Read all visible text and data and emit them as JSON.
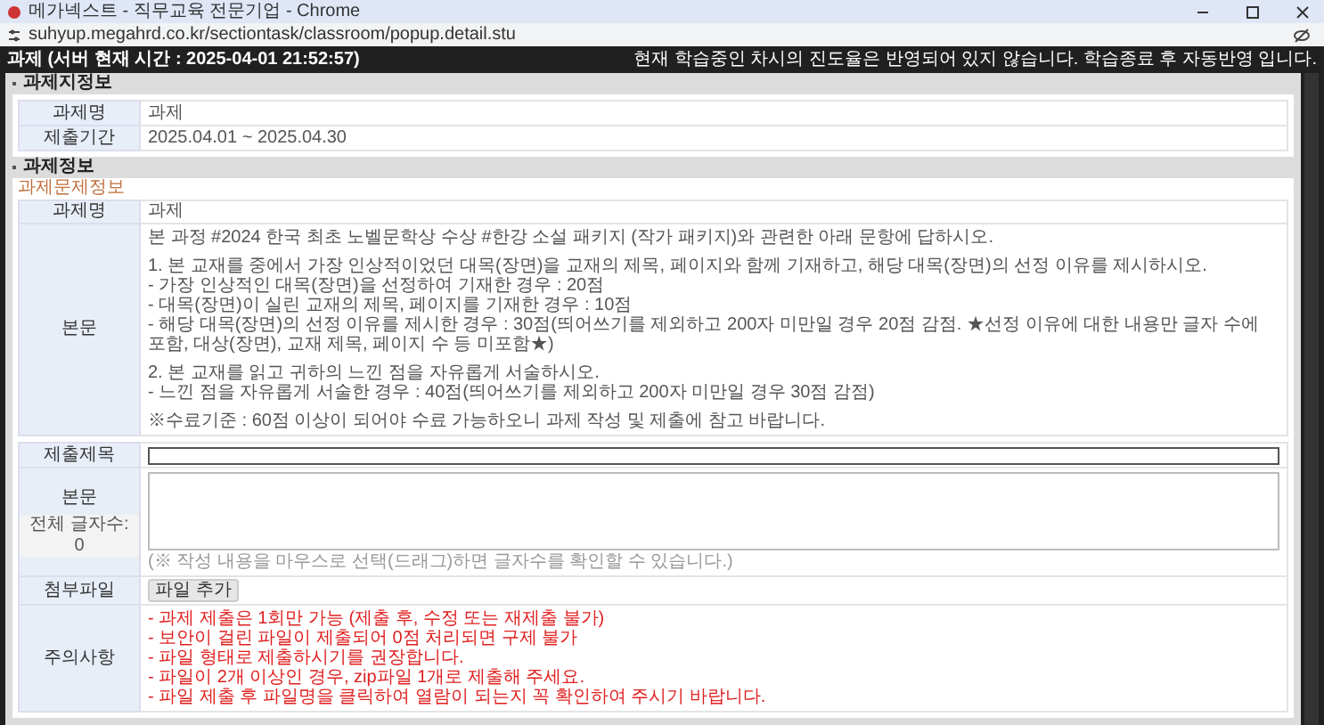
{
  "browser": {
    "title": "메가넥스트 - 직무교육 전문기업 - Chrome",
    "url": "suhyup.megahrd.co.kr/sectiontask/classroom/popup.detail.stu"
  },
  "header": {
    "title": "과제 (서버 현재 시간 : 2025-04-01 21:52:57)",
    "notice": "현재 학습중인 차시의 진도율은 반영되어 있지 않습니다. 학습종료 후 자동반영 입니다."
  },
  "assignment_info": {
    "heading": "과제지정보",
    "rows": [
      {
        "label": "과제명",
        "value": "과제"
      },
      {
        "label": "제출기간",
        "value": "2025.04.01 ~ 2025.04.30"
      }
    ]
  },
  "task_info": {
    "heading": "과제정보",
    "subheading": "과제문제정보",
    "rows": [
      {
        "label": "과제명",
        "value": "과제"
      }
    ],
    "body": {
      "label": "본문",
      "paragraphs": [
        [
          "본 과정 #2024 한국 최초 노벨문학상 수상 #한강 소설 패키지 (작가 패키지)와 관련한 아래 문항에 답하시오."
        ],
        [
          "1. 본 교재를 중에서 가장 인상적이었던 대목(장면)을 교재의 제목, 페이지와 함께 기재하고, 해당 대목(장면)의 선정 이유를 제시하시오.",
          "- 가장 인상적인 대목(장면)을 선정하여 기재한 경우 : 20점",
          "- 대목(장면)이 실린 교재의 제목, 페이지를 기재한 경우 : 10점",
          "- 해당 대목(장면)의 선정 이유를 제시한 경우 : 30점(띄어쓰기를 제외하고 200자 미만일 경우 20점 감점. ★선정 이유에 대한 내용만 글자 수에 포함, 대상(장면), 교재 제목, 페이지 수 등 미포함★)"
        ],
        [
          "2. 본 교재를 읽고 귀하의 느낀 점을 자유롭게 서술하시오.",
          "- 느낀 점을 자유롭게 서술한 경우 : 40점(띄어쓰기를 제외하고 200자 미만일 경우 30점 감점)"
        ],
        [
          "※수료기준 : 60점 이상이 되어야 수료 가능하오니 과제 작성 및 제출에 참고 바랍니다."
        ]
      ]
    }
  },
  "submission": {
    "title_label": "제출제목",
    "body_label": "본문",
    "char_count": "전체 글자수: 0",
    "hint": "(※ 작성 내용을 마우스로 선택(드래그)하면 글자수를 확인할 수 있습니다.)",
    "attach_label": "첨부파일",
    "attach_button": "파일 추가",
    "notes_label": "주의사항",
    "notes": [
      "- 과제 제출은 1회만 가능 (제출 후, 수정 또는 재제출 불가)",
      "- 보안이 걸린 파일이 제출되어 0점 처리되면 구제 불가",
      "- 파일 형태로 제출하시기를 권장합니다.",
      "- 파일이 2개 이상인 경우, zip파일 1개로 제출해 주세요.",
      "- 파일 제출 후 파일명을 클릭하여 열람이 되는지 꼭 확인하여 주시기 바랍니다."
    ]
  }
}
